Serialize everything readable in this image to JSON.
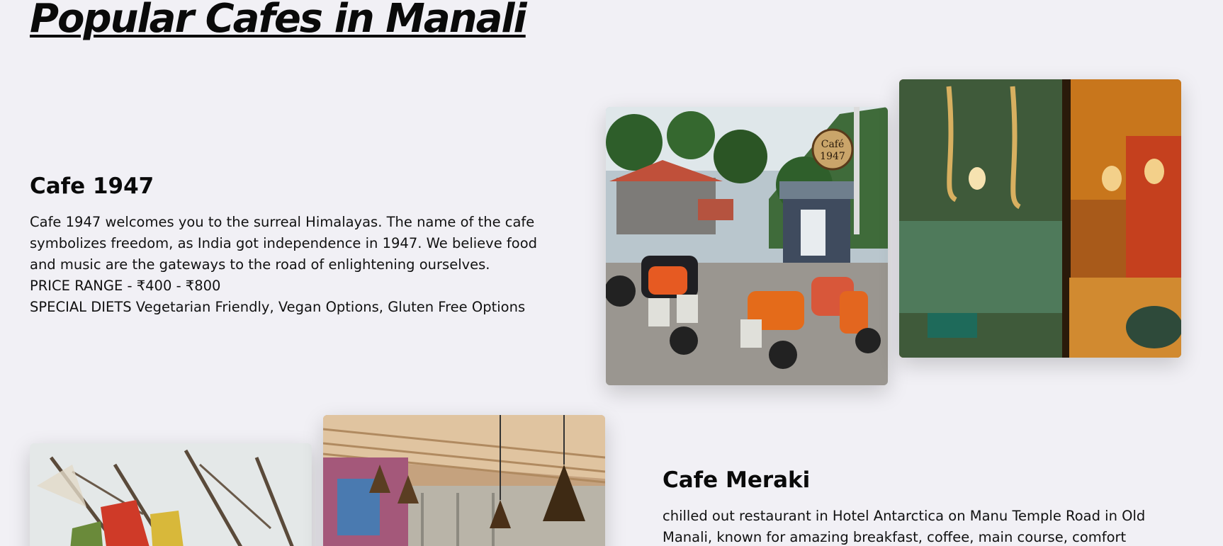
{
  "page": {
    "title": "Popular Cafes in Manali"
  },
  "cafes": [
    {
      "name": "Cafe 1947",
      "description": "Cafe 1947 welcomes you to the surreal Himalayas. The name of the cafe symbolizes freedom, as India got independence in 1947. We believe food and music are the gateways to the road of enlightening ourselves.",
      "price_range": "PRICE RANGE - ₹400 - ₹800",
      "special_diets": "SPECIAL DIETS Vegetarian Friendly, Vegan Options, Gluten Free Options",
      "sign_text_line1": "Café",
      "sign_text_line2": "1947"
    },
    {
      "name": "Cafe Meraki",
      "description": "chilled out restaurant in Hotel Antarctica on Manu Temple Road in Old Manali, known for amazing breakfast, coffee, main course, comfort food"
    }
  ]
}
